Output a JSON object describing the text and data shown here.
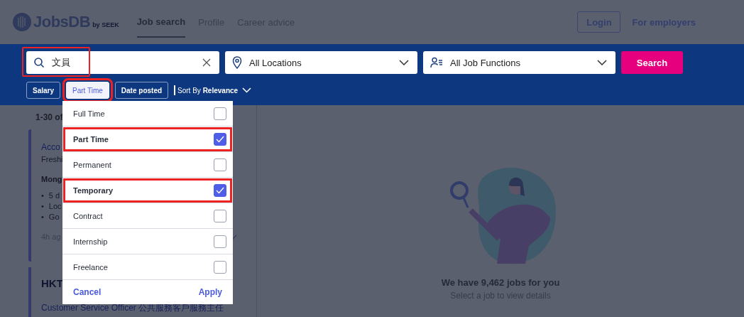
{
  "header": {
    "logo": "JobsDB",
    "logo_suffix": "by SEEK",
    "nav": [
      {
        "label": "Job search",
        "selected": true
      },
      {
        "label": "Profile",
        "selected": false
      },
      {
        "label": "Career advice",
        "selected": false
      }
    ],
    "login": "Login",
    "employers": "For employers"
  },
  "search": {
    "keyword": "文員",
    "annotated": true,
    "location": "All Locations",
    "function": "All Job Functions",
    "button": "Search"
  },
  "filters": [
    {
      "label": "Salary",
      "selected": false,
      "annotated": false
    },
    {
      "label": "Part Time",
      "selected": true,
      "annotated": true
    },
    {
      "label": "Date posted",
      "selected": false,
      "annotated": false
    }
  ],
  "sort": "Sort By **Relevance**",
  "dropdown": {
    "options": [
      {
        "label": "Full Time",
        "checked": false,
        "annotated": false
      },
      {
        "label": "Part Time",
        "checked": true,
        "annotated": true
      },
      {
        "label": "Permanent",
        "checked": false,
        "annotated": false
      },
      {
        "label": "Temporary",
        "checked": true,
        "annotated": true
      },
      {
        "label": "Contract",
        "checked": false,
        "annotated": false
      },
      {
        "label": "Internship",
        "checked": false,
        "annotated": false
      },
      {
        "label": "Freelance",
        "checked": false,
        "annotated": false
      }
    ],
    "cancel": "Cancel",
    "apply": "Apply"
  },
  "results": {
    "count": "1-30 of",
    "cards": [
      {
        "title": "Acco",
        "company": "Freshi",
        "location": "Mong",
        "bullets": [
          {
            "marker": "•",
            "text": "5 d"
          },
          {
            "marker": "•",
            "text": "Loc"
          },
          {
            "marker": "•",
            "text": "Go"
          }
        ],
        "time": "4h ag"
      },
      {
        "title": "HKT",
        "subtitle": "Customer Service Officer 公共服務客戶服務主任"
      }
    ]
  },
  "empty_state": {
    "title": "We have 9,462 jobs for you",
    "subtitle": "Select a job to view details"
  }
}
